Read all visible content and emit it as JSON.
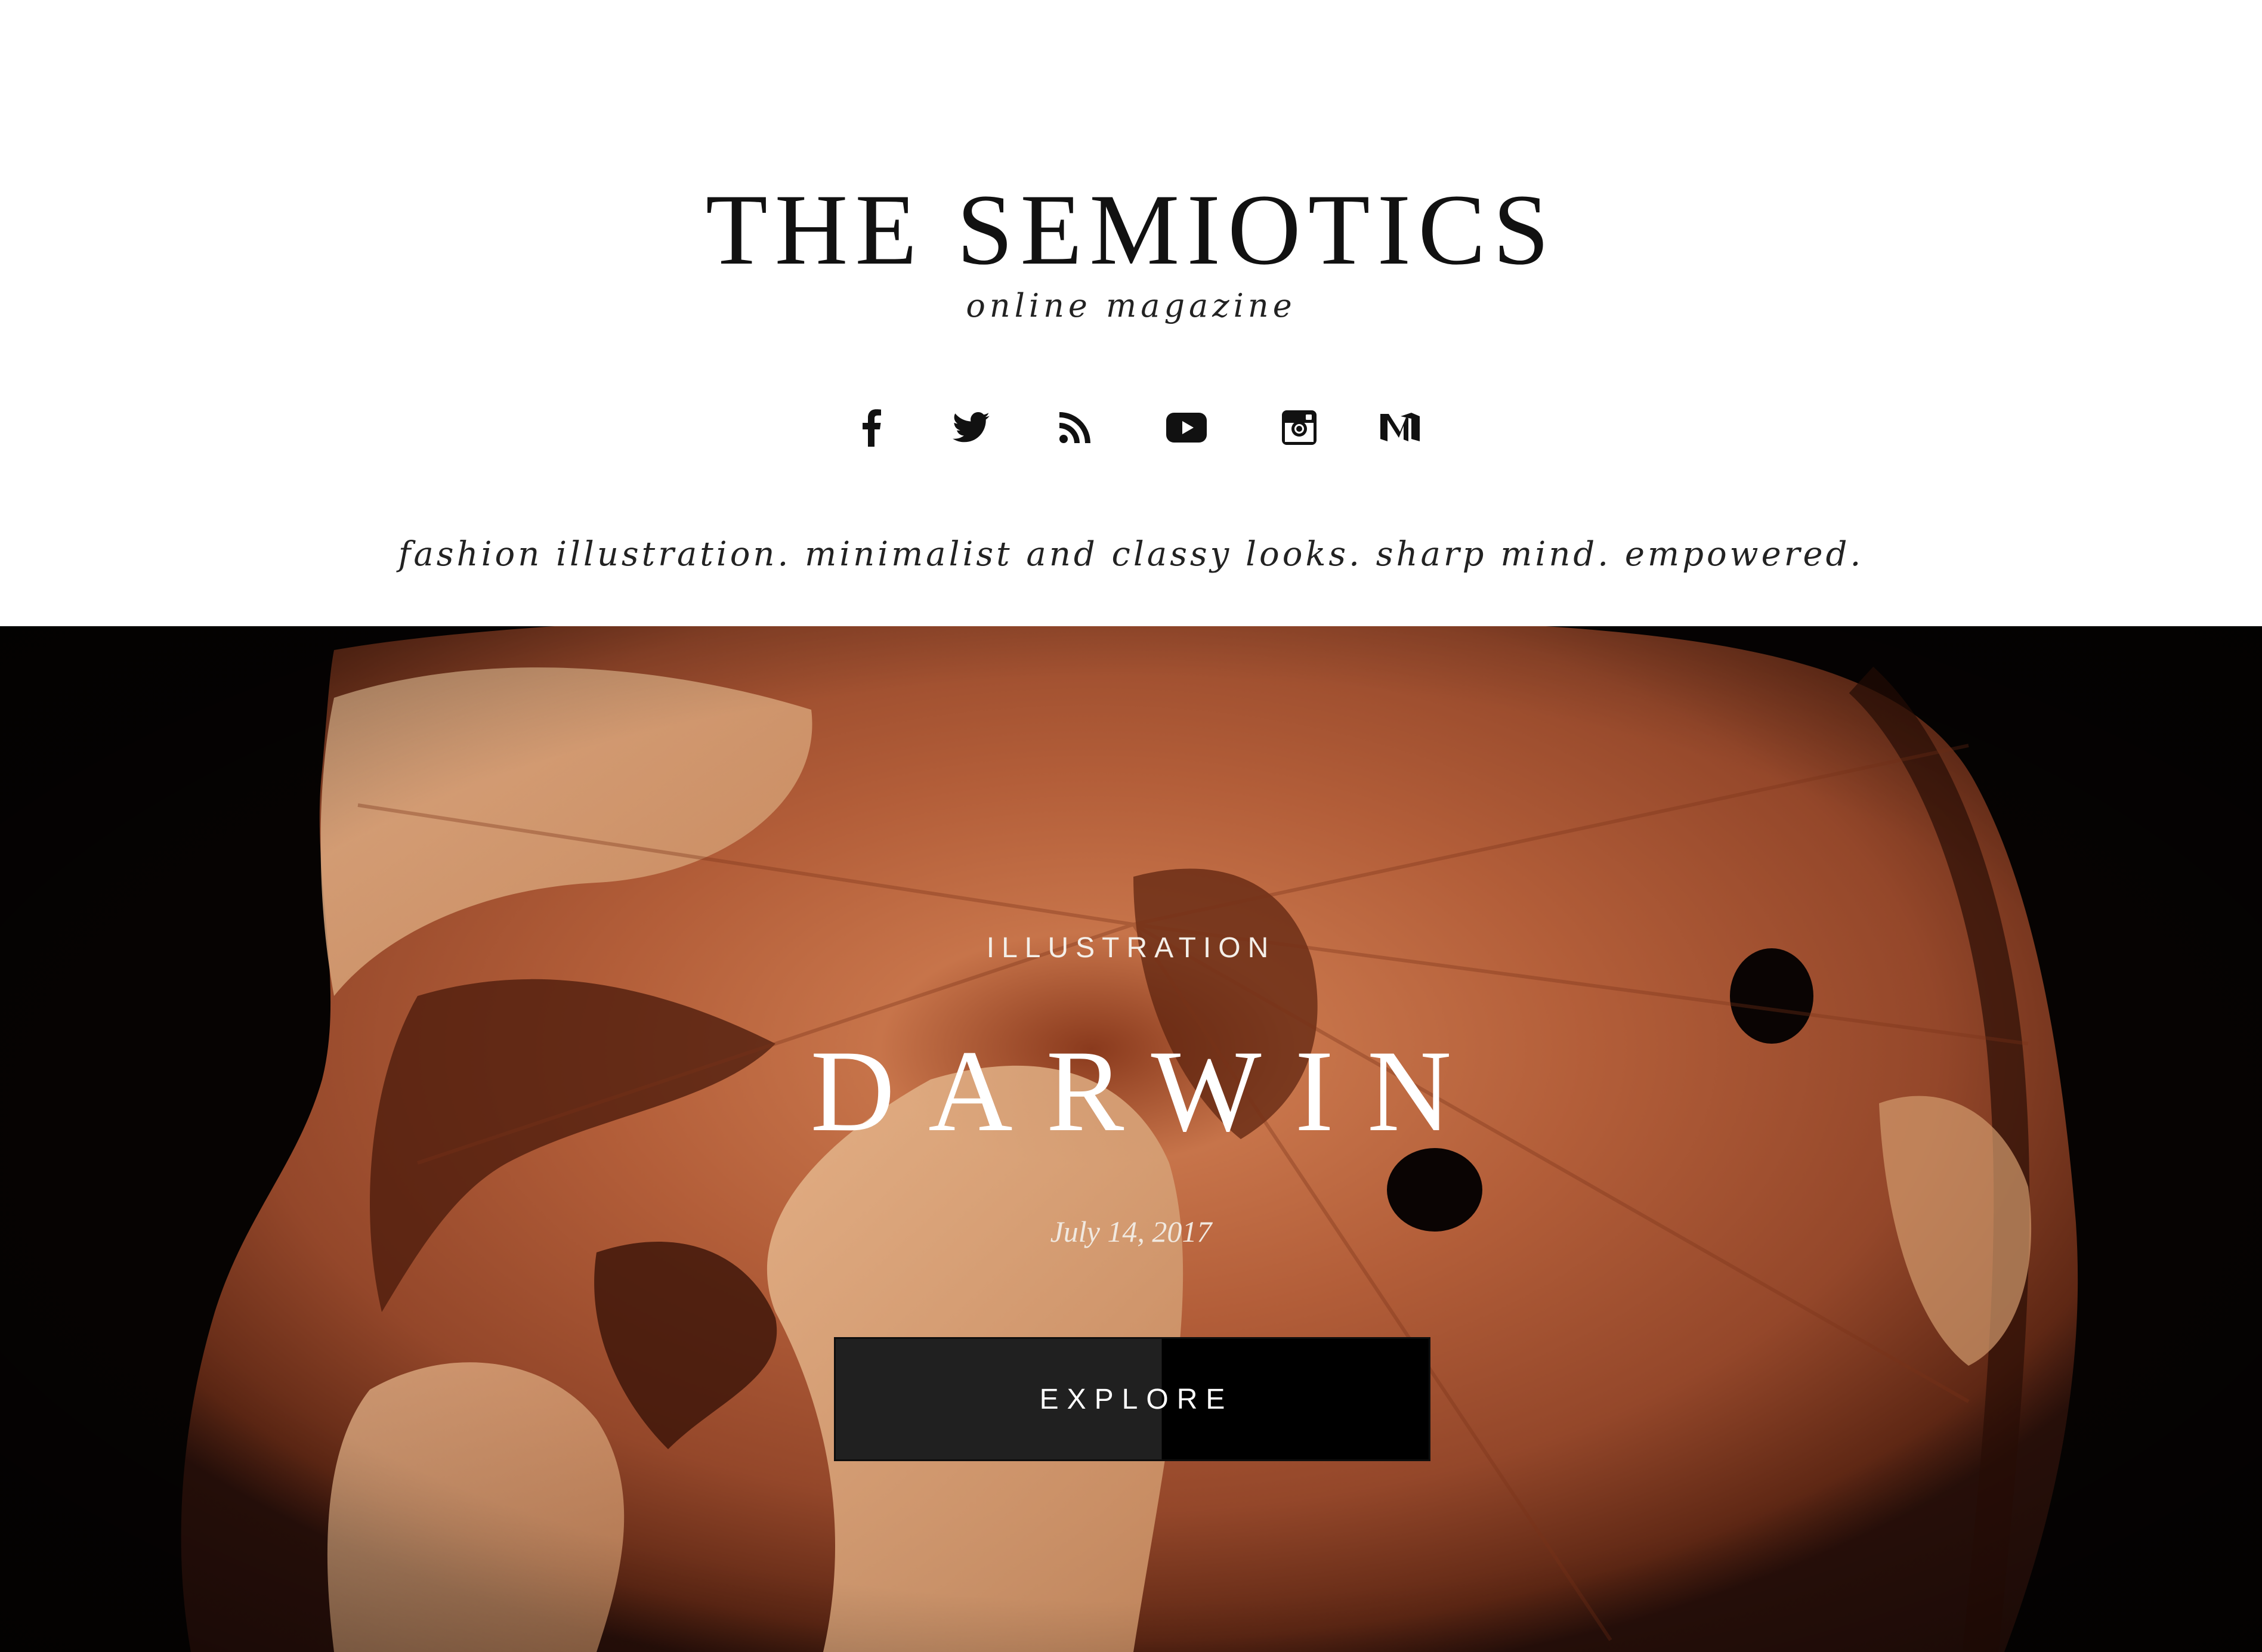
{
  "header": {
    "site_title": "THE SEMIOTICS",
    "site_subtitle": "online magazine",
    "tagline": "fashion illustration. minimalist and classy looks. sharp mind. empowered."
  },
  "social": {
    "icons": [
      {
        "name": "facebook-icon"
      },
      {
        "name": "twitter-icon"
      },
      {
        "name": "rss-icon"
      },
      {
        "name": "youtube-icon"
      },
      {
        "name": "instagram-icon"
      },
      {
        "name": "medium-icon"
      }
    ]
  },
  "hero": {
    "category": "ILLUSTRATION",
    "title": "DARWIN",
    "date": "July 14, 2017",
    "button_label": "EXPLORE"
  },
  "colors": {
    "background": "#ffffff",
    "text": "#111111",
    "hero_dark": "#050302",
    "wood_light": "#d9a57a",
    "wood_mid": "#b8683f",
    "wood_dark": "#6b2e17",
    "button_bg": "#202020"
  }
}
